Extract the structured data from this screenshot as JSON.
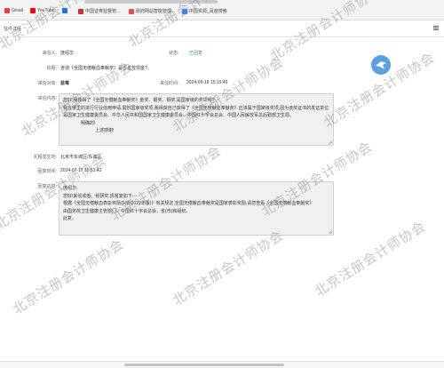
{
  "bookmarks": [
    {
      "label": "Gmail",
      "color": "#ea4335",
      "icon": "gmail-icon"
    },
    {
      "label": "YouTube",
      "color": "#ff0000",
      "icon": "youtube-icon"
    },
    {
      "label": "",
      "color": "#1a73e8",
      "icon": "map-icon"
    },
    {
      "label": "中国证券监督管...",
      "color": "#c0392b",
      "icon": "csrc-icon"
    },
    {
      "label": "政府网站智能管理...",
      "color": "#d9534f",
      "icon": "gov-icon"
    },
    {
      "label": "中国资源_百度搜索",
      "color": "#3385ff",
      "icon": "baidu-icon"
    }
  ],
  "page": {
    "title": "信件详情"
  },
  "fields": {
    "sender_label": "来信人:",
    "sender": "庞绍华",
    "status_label": "状态:",
    "status": "已回复",
    "subject_label": "标题:",
    "subject": "咨询《全国无偿献血奉献奖》是否发放现金?",
    "recipient_label": "来信对象:",
    "recipient": "蓝莓",
    "send_time_label": "来信时间:",
    "send_time": "2024-06-18 15:19:49",
    "content_label": "来信内容:",
    "content_lines": [
      "您好,我获得了《全国无偿献血奉献奖》金奖、银奖、铜奖,是国家级的奖项吗?",
      "我在哪里的进行行业信用申请,需附国家级奖项,我得获自己获得了《全国无偿献血奉献奖》应该属于国家级奖项,因为该奖证书的发证单位",
      "是国家卫生健康委员会、中华人民共和国国家卫生健康委员会、中国红十字会总会、中国人民解放军总后勤部卫生局。",
      "明确的!",
      "",
      "上述感谢!"
    ],
    "region_label": "问题发生地:",
    "region": "北京市东城区/东城区",
    "reply_time_label": "回复时间:",
    "reply_time": "2024-07-17 15:53:42",
    "reply_label": "回复内容:",
    "reply_lines": [
      "庞绍华:",
      "    您好!来信收悉。经研究,现答复如下:",
      "    根据《全国无偿献血表彰奖励办法(2022年版)》有关规定,全国无偿献血奉献奖是国家表彰奖励,请您查看《全国无偿献血奉献奖》",
      "由国务院卫生健康主管部门、中国红十字会总会、省(市)和组织。",
      "    此复。"
    ]
  },
  "watermark": {
    "text": "北京注册会计师协会"
  }
}
